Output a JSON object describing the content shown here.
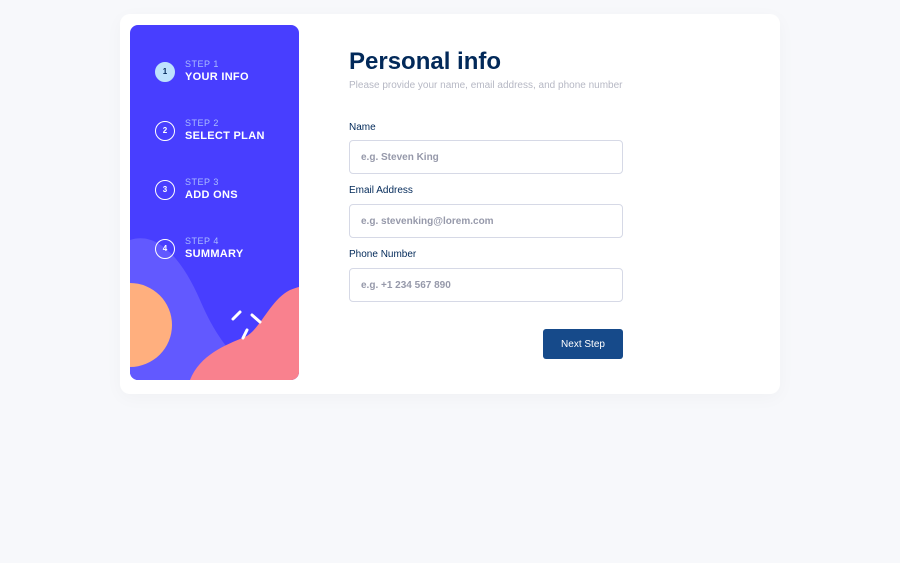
{
  "steps": [
    {
      "number": "1",
      "sub": "STEP 1",
      "title": "YOUR INFO",
      "active": true
    },
    {
      "number": "2",
      "sub": "STEP 2",
      "title": "SELECT PLAN",
      "active": false
    },
    {
      "number": "3",
      "sub": "STEP 3",
      "title": "ADD ONS",
      "active": false
    },
    {
      "number": "4",
      "sub": "STEP 4",
      "title": "SUMMARY",
      "active": false
    }
  ],
  "form": {
    "title": "Personal info",
    "subtitle": "Please provide your name, email address, and phone number",
    "name": {
      "label": "Name",
      "placeholder": "e.g. Steven King",
      "value": ""
    },
    "email": {
      "label": "Email Address",
      "placeholder": "e.g. stevenking@lorem.com",
      "value": ""
    },
    "phone": {
      "label": "Phone Number",
      "placeholder": "e.g. +1 234 567 890",
      "value": ""
    },
    "next_label": "Next Step"
  },
  "colors": {
    "sidebar_bg": "#483eff",
    "active_step_bg": "#bee2fd",
    "title": "#022959",
    "button": "#164a8a",
    "blob_pink": "#f9818e",
    "blob_orange": "#ffaf7e",
    "blob_purple": "#6259ff"
  }
}
